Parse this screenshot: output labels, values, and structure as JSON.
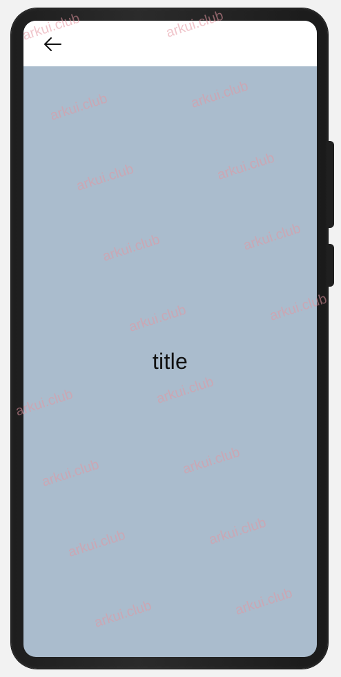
{
  "navigation": {
    "back_icon": "arrow-left-icon"
  },
  "content": {
    "title": "title"
  },
  "watermark": {
    "text": "arkui.club"
  },
  "colors": {
    "content_background": "#aabccd",
    "navbar_background": "#ffffff",
    "page_background": "#f2f2f2",
    "watermark": "#e496a0"
  }
}
